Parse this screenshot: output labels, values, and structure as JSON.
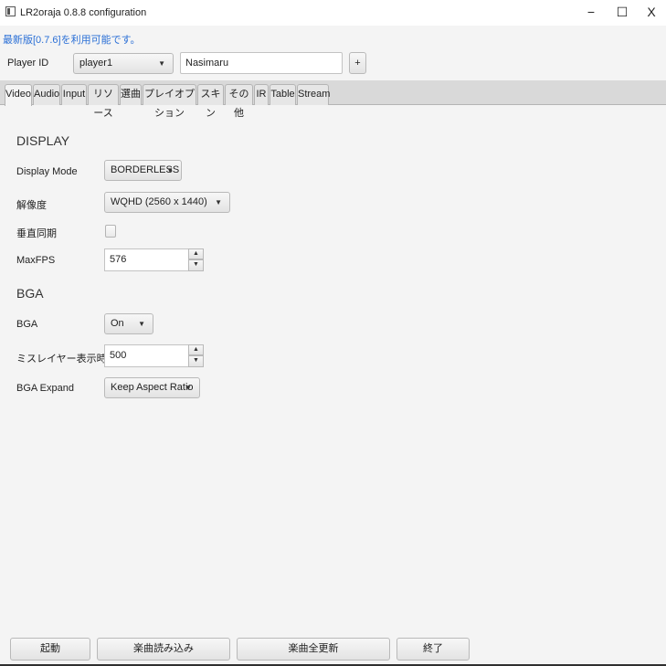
{
  "window": {
    "title": "LR2oraja 0.8.8 configuration",
    "minimize": "−",
    "maximize": "☐",
    "close": "X"
  },
  "update_notice": "最新版[0.7.6]を利用可能です。",
  "player": {
    "label": "Player ID",
    "selected": "player1",
    "name_value": "Nasimaru",
    "add_label": "+"
  },
  "tabs": [
    "Video",
    "Audio",
    "Input",
    "リソース",
    "選曲",
    "プレイオプション",
    "スキン",
    "その他",
    "IR",
    "Table",
    "Stream"
  ],
  "active_tab": "Video",
  "display": {
    "heading": "DISPLAY",
    "display_mode": {
      "label": "Display Mode",
      "value": "BORDERLESS"
    },
    "resolution": {
      "label": "解像度",
      "value": "WQHD (2560 x 1440)"
    },
    "vsync": {
      "label": "垂直同期",
      "checked": false
    },
    "maxfps": {
      "label": "MaxFPS",
      "value": "576"
    }
  },
  "bga": {
    "heading": "BGA",
    "bga": {
      "label": "BGA",
      "value": "On"
    },
    "miss_layer": {
      "label": "ミスレイヤー表示時間(ms)",
      "value": "500"
    },
    "expand": {
      "label": "BGA Expand",
      "value": "Keep Aspect Ratio"
    }
  },
  "footer": {
    "start": "起動",
    "load_songs": "楽曲読み込み",
    "update_all": "楽曲全更新",
    "exit": "終了"
  },
  "icons": {
    "dropdown": "▼",
    "spin_up": "▲",
    "spin_down": "▼"
  }
}
